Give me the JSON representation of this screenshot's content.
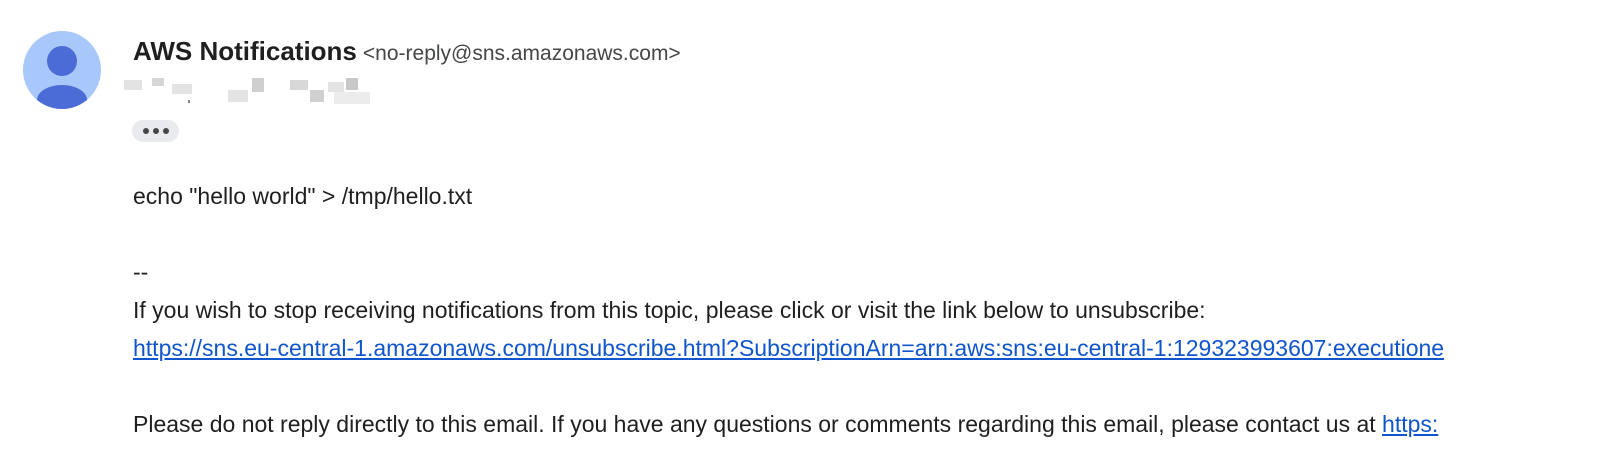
{
  "sender": {
    "name": "AWS Notifications",
    "email": "<no-reply@sns.amazonaws.com>"
  },
  "body": {
    "command": "echo \"hello world\" > /tmp/hello.txt",
    "separator": "--",
    "unsubscribe_notice": "If you wish to stop receiving notifications from this topic, please click or visit the link below to unsubscribe:",
    "unsubscribe_link": "https://sns.eu-central-1.amazonaws.com/unsubscribe.html?SubscriptionArn=arn:aws:sns:eu-central-1:129323993607:executione",
    "contact_notice": "Please do not reply directly to this email. If you have any questions or comments regarding this email, please contact us at ",
    "contact_link": "https:"
  },
  "colors": {
    "avatar_background": "#a8c7fa",
    "avatar_figure": "#4b6bd6",
    "link": "#1155cc"
  }
}
